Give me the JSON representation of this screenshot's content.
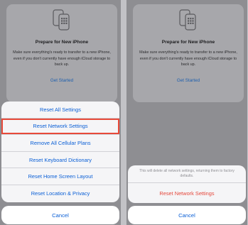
{
  "card": {
    "title": "Prepare for New iPhone",
    "description": "Make sure everything's ready to transfer to a new iPhone, even if you don't currently have enough iCloud storage to back up.",
    "link": "Get Started"
  },
  "left_sheet": {
    "items": [
      "Reset All Settings",
      "Reset Network Settings",
      "Remove All Cellular Plans",
      "Reset Keyboard Dictionary",
      "Reset Home Screen Layout",
      "Reset Location & Privacy"
    ],
    "cancel": "Cancel"
  },
  "right_sheet": {
    "message": "This will delete all network settings, returning them to factory defaults.",
    "destructive": "Reset Network Settings",
    "cancel": "Cancel"
  },
  "colors": {
    "accent": "#0a5fd6",
    "destructive": "#e5483c",
    "highlight": "#e84a3a"
  }
}
